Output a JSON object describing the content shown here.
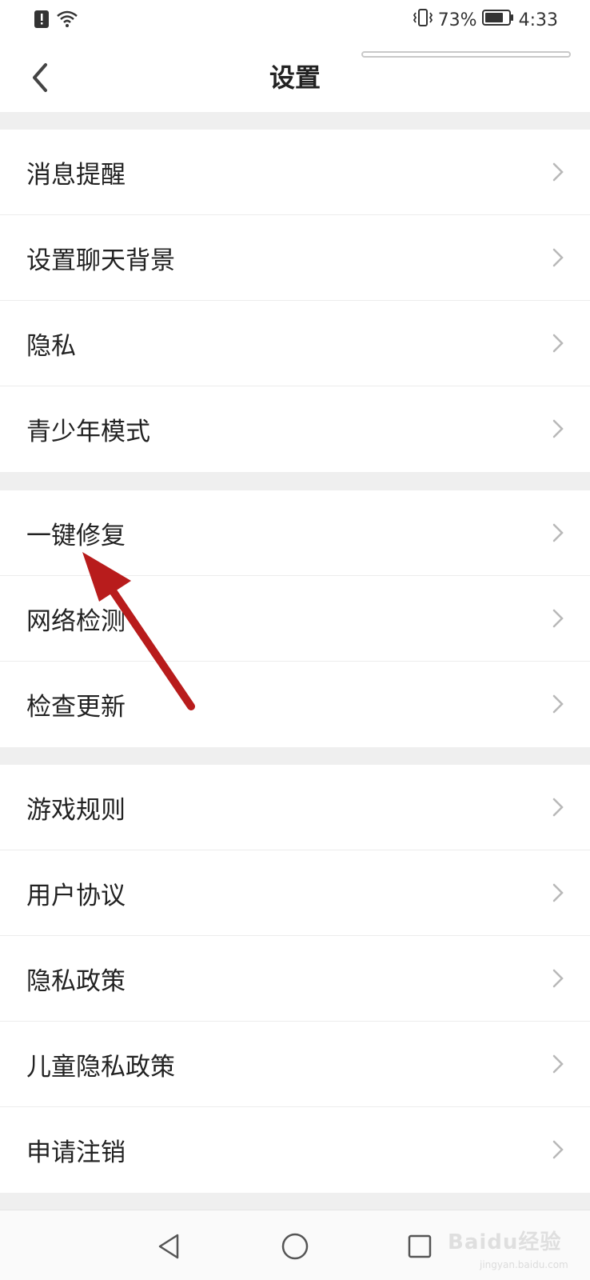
{
  "status_bar": {
    "battery": "73%",
    "time": "4:33"
  },
  "header": {
    "title": "设置"
  },
  "groups": [
    {
      "items": [
        {
          "label": "消息提醒"
        },
        {
          "label": "设置聊天背景"
        },
        {
          "label": "隐私"
        },
        {
          "label": "青少年模式"
        }
      ]
    },
    {
      "items": [
        {
          "label": "一键修复"
        },
        {
          "label": "网络检测"
        },
        {
          "label": "检查更新"
        }
      ]
    },
    {
      "items": [
        {
          "label": "游戏规则"
        },
        {
          "label": "用户协议"
        },
        {
          "label": "隐私政策"
        },
        {
          "label": "儿童隐私政策"
        },
        {
          "label": "申请注销"
        }
      ]
    }
  ],
  "annotation": {
    "color": "#b81c1c"
  },
  "watermark": {
    "brand": "Baidu经验",
    "url": "jingyan.baidu.com"
  }
}
